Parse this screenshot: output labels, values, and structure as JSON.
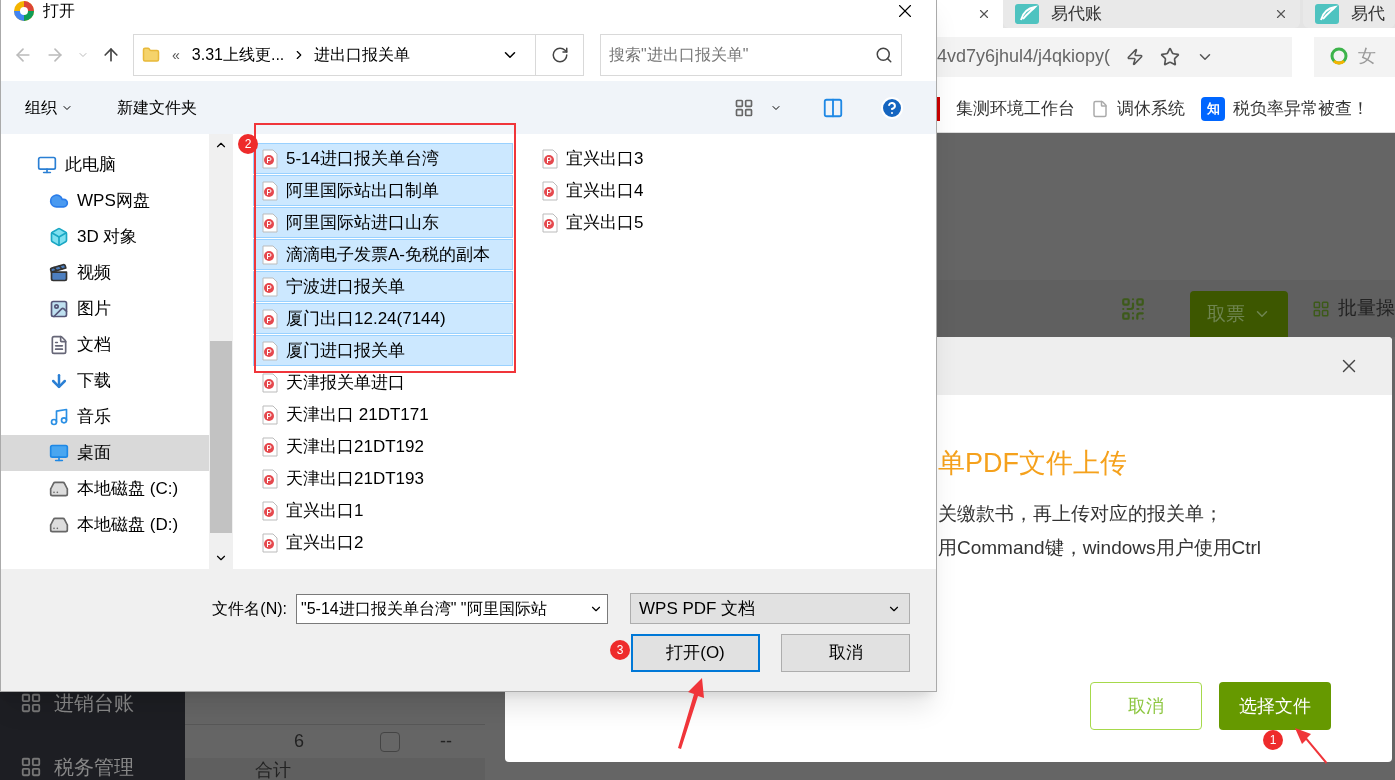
{
  "browser": {
    "tabs": [
      {
        "title": "易代账",
        "selected": false
      },
      {
        "title": "易代",
        "selected": false
      }
    ],
    "address": "4vd7y6jhul4/j4qkiopy(",
    "search": "女",
    "bookmarks": [
      "集测环境工作台",
      "调休系统",
      "税负率异常被查！"
    ],
    "bookmark_logo": "知"
  },
  "page": {
    "toolbar": {
      "primary_button": "取票",
      "batch_action": "批量操"
    },
    "sidebar": [
      "进销台账",
      "税务管理"
    ],
    "table": {
      "rows": [
        {
          "index": "6",
          "checked": false,
          "cell": "--"
        }
      ],
      "footer": "合计"
    }
  },
  "upload_modal": {
    "title": "单PDF文件上传",
    "lines": [
      "关缴款书，再上传对应的报关单；",
      "用Command键，windows用户使用Ctrl"
    ],
    "buttons": [
      {
        "label": "取消",
        "kind": "secondary"
      },
      {
        "label": "选择文件",
        "kind": "primary"
      }
    ]
  },
  "file_dialog": {
    "title": "打开",
    "breadcrumb": [
      "«",
      "3.31上线更...",
      "进出口报关单"
    ],
    "search_placeholder": "搜索\"进出口报关单\"",
    "toolbar": [
      "组织",
      "新建文件夹"
    ],
    "nav": [
      {
        "label": "此电脑",
        "kind": "computer",
        "selected": false
      },
      {
        "label": "WPS网盘",
        "kind": "cloud",
        "selected": false
      },
      {
        "label": "3D 对象",
        "kind": "cube",
        "selected": false
      },
      {
        "label": "视频",
        "kind": "video",
        "selected": false
      },
      {
        "label": "图片",
        "kind": "image",
        "selected": false
      },
      {
        "label": "文档",
        "kind": "document",
        "selected": false
      },
      {
        "label": "下载",
        "kind": "download",
        "selected": false
      },
      {
        "label": "音乐",
        "kind": "music",
        "selected": false
      },
      {
        "label": "桌面",
        "kind": "desktop",
        "selected": true
      },
      {
        "label": "本地磁盘 (C:)",
        "kind": "drive",
        "selected": false
      },
      {
        "label": "本地磁盘 (D:)",
        "kind": "drive",
        "selected": false
      }
    ],
    "files": [
      {
        "name": "5-14进口报关单台湾",
        "selected": true
      },
      {
        "name": "阿里国际站出口制单",
        "selected": true
      },
      {
        "name": "阿里国际站进口山东",
        "selected": true
      },
      {
        "name": "滴滴电子发票A-免税的副本",
        "selected": true
      },
      {
        "name": "宁波进口报关单",
        "selected": true
      },
      {
        "name": "厦门出口12.24(7144)",
        "selected": true
      },
      {
        "name": "厦门进口报关单",
        "selected": true
      },
      {
        "name": "天津报关单进口",
        "selected": false
      },
      {
        "name": "天津出口 21DT171",
        "selected": false
      },
      {
        "name": "天津出口21DT192",
        "selected": false
      },
      {
        "name": "天津出口21DT193",
        "selected": false
      },
      {
        "name": "宜兴出口1",
        "selected": false
      },
      {
        "name": "宜兴出口2",
        "selected": false
      },
      {
        "name": "宜兴出口3",
        "selected": false
      },
      {
        "name": "宜兴出口4",
        "selected": false
      },
      {
        "name": "宜兴出口5",
        "selected": false
      }
    ],
    "filename_label": "文件名(N):",
    "filename_value": "\"5-14进口报关单台湾\" \"阿里国际站",
    "file_type": "WPS PDF 文档",
    "buttons": [
      {
        "label": "打开(O)",
        "kind": "default"
      },
      {
        "label": "取消",
        "kind": "normal"
      }
    ]
  },
  "annotations": [
    {
      "label": "2"
    },
    {
      "label": "3"
    },
    {
      "label": "1"
    }
  ]
}
